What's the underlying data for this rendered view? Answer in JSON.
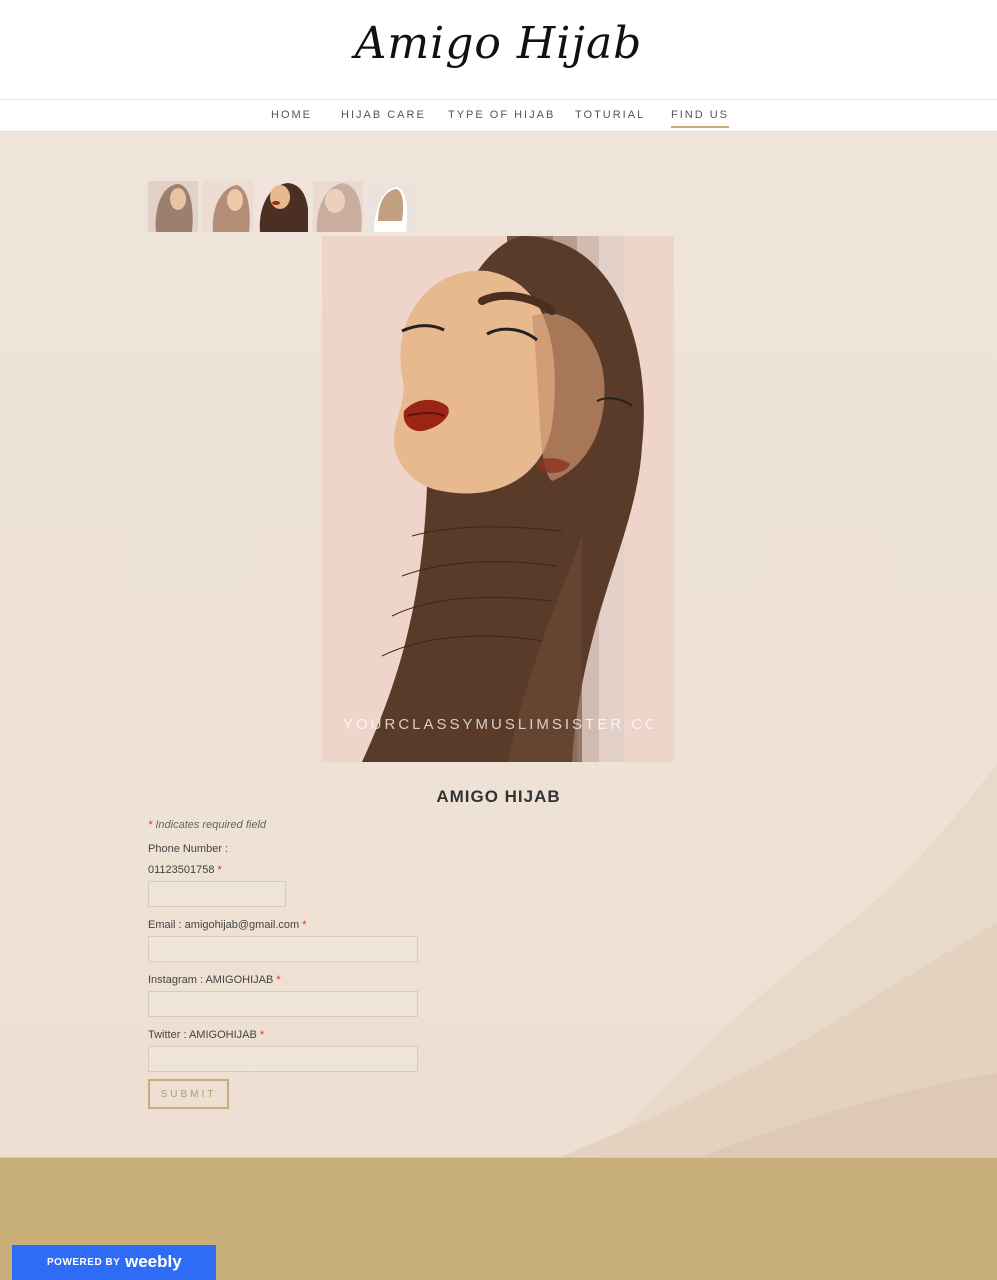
{
  "site": {
    "title": "Amigo Hijab"
  },
  "nav": {
    "items": [
      {
        "label": "HOME"
      },
      {
        "label": "HIJAB CARE"
      },
      {
        "label": "TYPE OF HIJAB"
      },
      {
        "label": "TOTURIAL"
      },
      {
        "label": "FIND US"
      }
    ],
    "active": "FIND US"
  },
  "gallery": {
    "thumbnail_count": 5,
    "image_watermark": "YOURCLASSYMUSLIMSISTER.COM"
  },
  "form": {
    "title": "AMIGO HIJAB",
    "required_note": "Indicates required field",
    "required_marker": "*",
    "fields": [
      {
        "label_line1": "Phone Number :",
        "label_line2": "01123501758",
        "value": ""
      },
      {
        "label": "Email : amigohijab@gmail.com",
        "value": ""
      },
      {
        "label": "Instagram : AMIGOHIJAB",
        "value": ""
      },
      {
        "label": "Twitter : AMIGOHIJAB",
        "value": ""
      }
    ],
    "submit_label": "SUBMIT"
  },
  "footer": {
    "badge_prefix": "POWERED BY",
    "badge_brand": "weebly"
  },
  "colors": {
    "accent": "#c8ad7b",
    "footer": "#c8ae79",
    "badge": "#2f6cf5",
    "required": "#d9342b"
  }
}
